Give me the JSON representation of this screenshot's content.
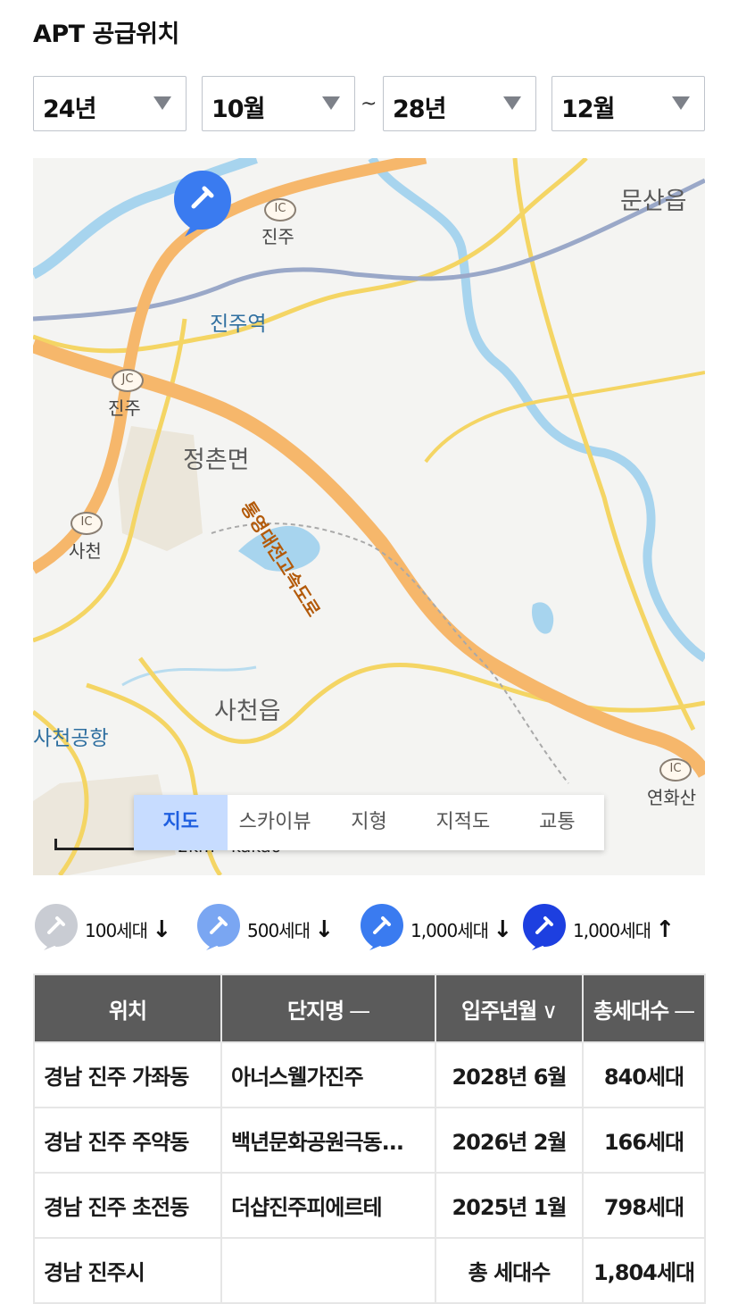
{
  "header": {
    "title": "APT 공급위치"
  },
  "filters": {
    "start_year": "24년",
    "start_month": "10월",
    "separator": "~",
    "end_year": "28년",
    "end_month": "12월"
  },
  "map": {
    "labels": {
      "jinju_ic": "진주",
      "jinju_station": "진주역",
      "jinju_jc": "진주",
      "jeongchon": "정촌면",
      "sacheon_ic": "사천",
      "sacheon_eup": "사천읍",
      "sacheon_airport": "사천공항",
      "munsan": "문산읍",
      "yeonhwa": "연화산",
      "highway": "통영대전고속도로",
      "ic_badge": "IC",
      "jc_badge": "JC",
      "scale": "2km",
      "provider": "kakao"
    },
    "tabs": [
      "지도",
      "스카이뷰",
      "지형",
      "지적도",
      "교통"
    ],
    "active_tab": "지도"
  },
  "legend": [
    {
      "label": "100세대",
      "arrow": "↓",
      "color": "#c9ccd3"
    },
    {
      "label": "500세대",
      "arrow": "↓",
      "color": "#7aa6f2"
    },
    {
      "label": "1,000세대",
      "arrow": "↓",
      "color": "#3a7bf0"
    },
    {
      "label": "1,000세대",
      "arrow": "↑",
      "color": "#1d3fe0"
    }
  ],
  "table": {
    "headers": {
      "location": "위치",
      "complex": "단지명",
      "complex_sort": "—",
      "move_in": "입주년월",
      "move_in_sort": "∨",
      "units": "총세대수",
      "units_sort": "—"
    },
    "rows": [
      {
        "location": "경남 진주 가좌동",
        "complex": "아너스웰가진주",
        "move_in": "2028년 6월",
        "units": "840세대"
      },
      {
        "location": "경남 진주 주약동",
        "complex": "백년문화공원극동...",
        "move_in": "2026년 2월",
        "units": "166세대"
      },
      {
        "location": "경남 진주 초전동",
        "complex": "더샵진주피에르테",
        "move_in": "2025년 1월",
        "units": "798세대"
      }
    ],
    "total": {
      "location": "경남 진주시",
      "complex": "",
      "move_in": "총 세대수",
      "units": "1,804세대"
    }
  },
  "colors": {
    "accent": "#1f5fe0",
    "header_bg": "#5b5b5b"
  }
}
